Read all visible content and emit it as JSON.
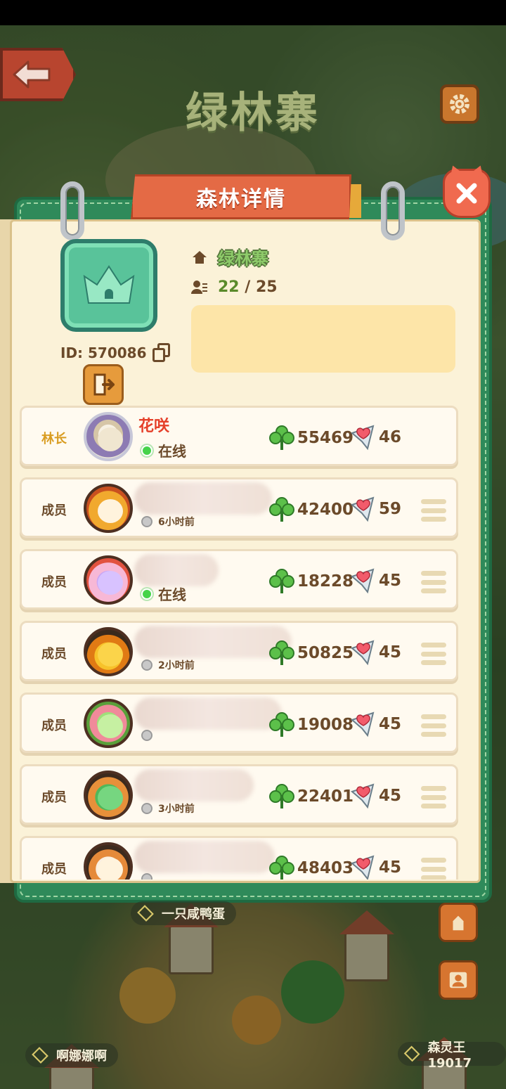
{
  "screen": {
    "map_title": "绿林寨",
    "map_labels": [
      "一只咸鸭蛋",
      "啊娜娜啊",
      "森灵王19017"
    ]
  },
  "panel": {
    "title": "森林详情",
    "forest_name": "绿林寨",
    "member_count": "22",
    "member_max": "25",
    "forest_id": "ID: 570086",
    "announcement": ""
  },
  "members": [
    {
      "role": "林长",
      "name": "花咲",
      "status": "在线",
      "online": true,
      "clovers": "55469",
      "likes": "46",
      "has_menu": false
    },
    {
      "role": "成员",
      "name": "",
      "status": "6小时前",
      "online": false,
      "clovers": "42400",
      "likes": "59",
      "has_menu": true
    },
    {
      "role": "成员",
      "name": "",
      "status": "在线",
      "online": true,
      "clovers": "18228",
      "likes": "45",
      "has_menu": true
    },
    {
      "role": "成员",
      "name": "",
      "status": "2小时前",
      "online": false,
      "clovers": "50825",
      "likes": "45",
      "has_menu": true
    },
    {
      "role": "成员",
      "name": "",
      "status": "",
      "online": false,
      "clovers": "19008",
      "likes": "45",
      "has_menu": true
    },
    {
      "role": "成员",
      "name": "",
      "status": "3小时前",
      "online": false,
      "clovers": "22401",
      "likes": "45",
      "has_menu": true
    },
    {
      "role": "成员",
      "name": "",
      "status": "",
      "online": false,
      "clovers": "48403",
      "likes": "45",
      "has_menu": true
    }
  ],
  "colors": {
    "accent_green": "#2f8a5a",
    "ribbon": "#e46a45",
    "close": "#f06a4f",
    "leader_role": "#d99c20",
    "leader_name": "#e5402a",
    "online": "#46d34a"
  },
  "icons": [
    "back-arrow-icon",
    "gear-icon",
    "close-icon",
    "crown-emblem-icon",
    "house-icon",
    "members-icon",
    "copy-icon",
    "exit-door-icon",
    "clover-icon",
    "heart-icon",
    "menu-icon",
    "online-dot-icon"
  ]
}
